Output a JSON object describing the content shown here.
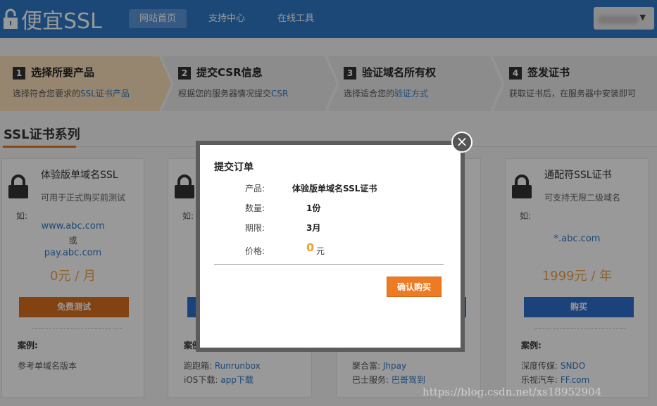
{
  "header": {
    "logo_text": "便宜SSL",
    "nav": [
      {
        "label": "网站首页",
        "active": true
      },
      {
        "label": "支持中心",
        "active": false
      },
      {
        "label": "在线工具",
        "active": false
      }
    ],
    "user_caret": "▼"
  },
  "steps": [
    {
      "num": "1",
      "title": "选择所要产品",
      "desc_pre": "选择符合您要求的",
      "desc_link": "SSL证书产品",
      "desc_post": ""
    },
    {
      "num": "2",
      "title": "提交CSR信息",
      "desc_pre": "根据您的服务器情况提交",
      "desc_link": "CSR",
      "desc_post": ""
    },
    {
      "num": "3",
      "title": "验证域名所有权",
      "desc_pre": "选择适合您的",
      "desc_link": "验证方式",
      "desc_post": ""
    },
    {
      "num": "4",
      "title": "签发证书",
      "desc_pre": "获取证书后，在服务器中安装即可",
      "desc_link": "",
      "desc_post": ""
    }
  ],
  "section": {
    "title": "SSL证书系列"
  },
  "cards": [
    {
      "title": "体验版单域名SSL",
      "subtitle": "可用于正式购买前测试",
      "ru": "如:",
      "domain1": "www.abc.com",
      "or": "或",
      "domain2": "pay.abc.com",
      "price": "0元 / 月",
      "button": "免费测试",
      "case_label": "案例:",
      "case_lines": [
        {
          "pre": "参考单域名版本",
          "link": ""
        }
      ]
    },
    {
      "ru": "如:",
      "case_label": "案例",
      "case_lines": [
        {
          "pre": "跑跑箱:",
          "link": "Runrunbox"
        },
        {
          "pre": "iOS下载:",
          "link": "app下载"
        }
      ]
    },
    {
      "case_lines": [
        {
          "pre": "聚合富:",
          "link": "Jhpay"
        },
        {
          "pre": "巴士服务:",
          "link": "巴哥驾到"
        }
      ]
    },
    {
      "title": "通配符SSL证书",
      "subtitle": "可支持无限二级域名",
      "ru": "如:",
      "domain1": "*.abc.com",
      "price": "1999元 / 年",
      "button": "购买",
      "case_label": "案例:",
      "case_lines": [
        {
          "pre": "深度传媒:",
          "link": "SNDO"
        },
        {
          "pre": "乐视汽车:",
          "link": "FF.com"
        }
      ]
    }
  ],
  "modal": {
    "title": "提交订单",
    "product_label": "产品:",
    "product_value": "体验版单域名SSL证书",
    "qty_label": "数量:",
    "qty_value": "1份",
    "term_label": "期限:",
    "term_value": "3月",
    "price_label": "价格:",
    "price_value": "0",
    "price_unit": "元",
    "confirm_label": "确认购买",
    "close_symbol": "×"
  },
  "watermark": "https://blog.csdn.net/xs18952904",
  "colors": {
    "header": "#2f78c7",
    "accent": "#ee7a23",
    "price": "#f0a44b",
    "blue_button": "#2f6fcf"
  }
}
